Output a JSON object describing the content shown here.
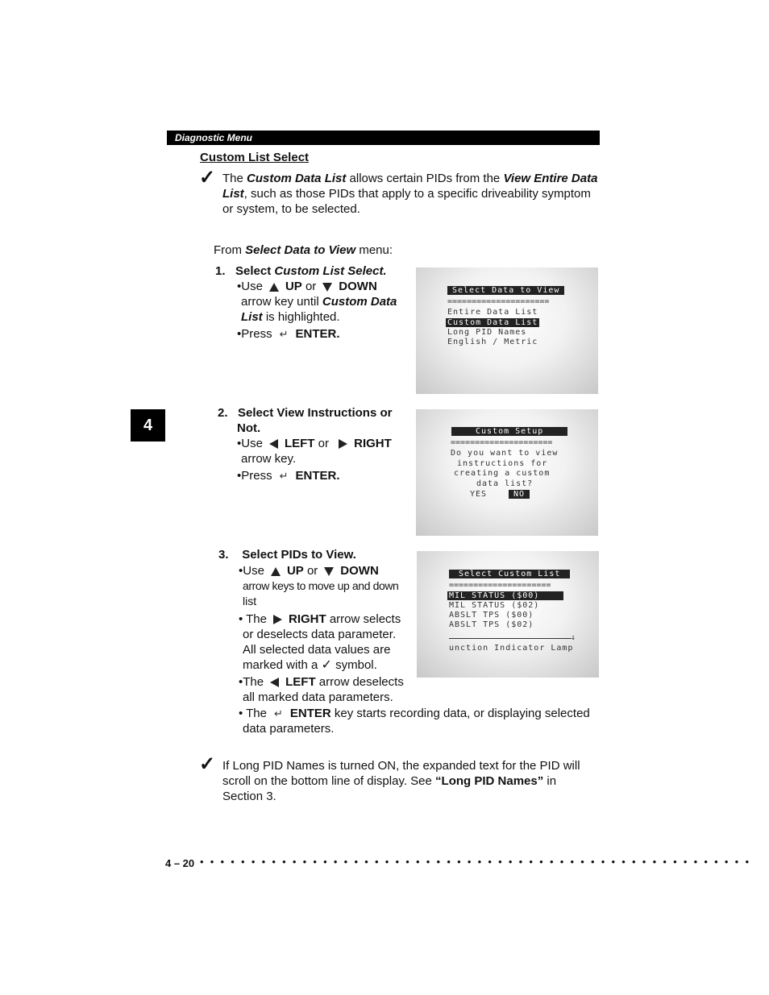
{
  "header": {
    "section": "Diagnostic Menu"
  },
  "side_tab": "4",
  "title": "Custom List Select",
  "intro": {
    "check_icon": "check-mark-icon",
    "t1": "The ",
    "t2": "Custom Data List",
    "t3": " allows certain PIDs from the ",
    "t4": "View Entire Data List",
    "t5": ", such as those PIDs that apply to a specific driveability symptom or system, to be selected."
  },
  "from": {
    "t1": "From ",
    "t2": "Select Data to View",
    "t3": " menu:"
  },
  "steps": [
    {
      "num": "1.",
      "title_a": "Select ",
      "title_b": "Custom List Select.",
      "use": "•Use",
      "up": "UP",
      "or": " or",
      "down": "DOWN",
      "line2a": "arrow key until ",
      "line2b": "Custom Data",
      "line3a": "List",
      "line3b": " is highlighted.",
      "press": "•Press",
      "enter": "ENTER."
    },
    {
      "num": "2.",
      "title": "Select View Instructions or",
      "title2": "Not.",
      "use": "•Use",
      "left": "LEFT",
      "or": " or ",
      "right": "RIGHT",
      "line2": "arrow key.",
      "press": "•Press",
      "enter": "ENTER."
    },
    {
      "num": "3.",
      "title": "Select PIDs to View.",
      "use": "•Use",
      "up": "UP",
      "or": " or",
      "down": "DOWN",
      "line2": "arrow keys to move up and down",
      "line3": "list",
      "right_a": "• The",
      "right_b": "RIGHT",
      "right_c": " arrow selects",
      "right_d": "or deselects data parameter.",
      "right_e": "All selected data values are",
      "right_f": "marked with a",
      "right_g": " symbol.",
      "left_a": "•The",
      "left_b": "LEFT",
      "left_c": " arrow deselects",
      "left_d": "all marked data parameters.",
      "enter_a": "• The",
      "enter_b": "ENTER",
      "enter_c": " key starts recording data, or displaying selected",
      "enter_d": "data parameters."
    }
  ],
  "screens": [
    {
      "title": "Select Data to View",
      "sep": "=====================",
      "items": [
        "Entire Data List",
        "Custom Data List",
        "Long PID Names",
        "English / Metric"
      ],
      "highlighted_index": 1
    },
    {
      "title": "Custom Setup",
      "sep": "=====================",
      "lines": [
        "Do you want to view",
        "instructions for",
        "creating a custom",
        "data list?"
      ],
      "yes": "YES",
      "no": "NO",
      "selected": "NO"
    },
    {
      "title": "Select Custom List",
      "sep": "=====================",
      "items": [
        "MIL STATUS ($00)",
        "MIL STATUS ($02)",
        "ABSLT TPS ($00)",
        "ABSLT TPS ($02)"
      ],
      "highlighted_index": 0,
      "scroll_arrow": "↓",
      "long_name": "unction Indicator Lamp"
    }
  ],
  "note": {
    "t1": "If Long PID Names is turned ON, the expanded text for the PID will scroll on the bottom line of display. See ",
    "t2": "“Long PID Names”",
    "t3": " in Section 3."
  },
  "footer": {
    "page": "4 – 20"
  }
}
